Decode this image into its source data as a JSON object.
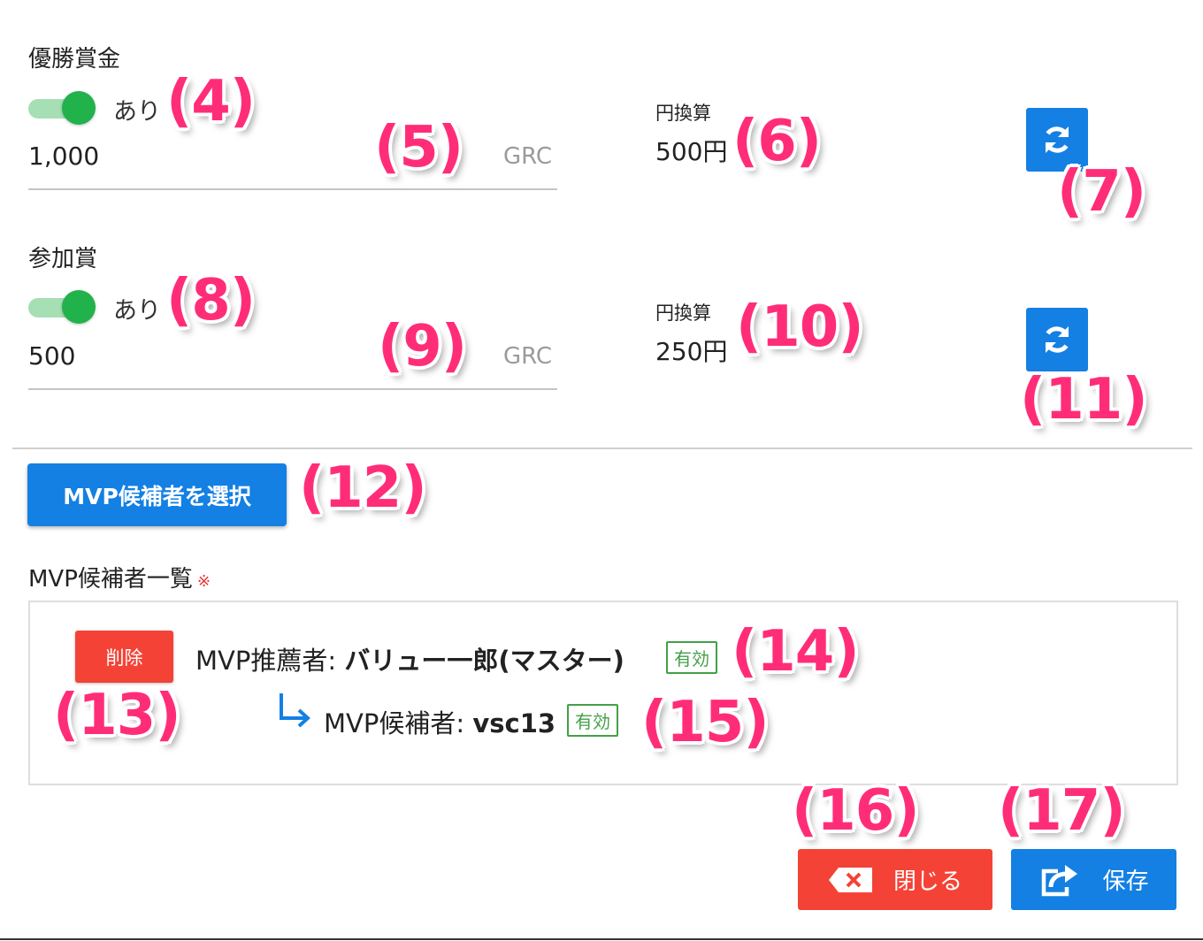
{
  "grand_prize": {
    "label": "優勝賞金",
    "toggle_label": "あり",
    "amount": "1,000",
    "unit": "GRC",
    "yen_label": "円換算",
    "yen_value": "500円"
  },
  "participation_prize": {
    "label": "参加賞",
    "toggle_label": "あり",
    "amount": "500",
    "unit": "GRC",
    "yen_label": "円換算",
    "yen_value": "250円"
  },
  "select_mvp_button": "MVP候補者を選択",
  "mvp_list": {
    "label": "MVP候補者一覧",
    "required_mark": "※",
    "delete_button": "削除",
    "recommender_prefix": "MVP推薦者: ",
    "recommender_name": "バリュー一郎(マスター)",
    "recommender_status": "有効",
    "candidate_prefix": "MVP候補者: ",
    "candidate_name": "vsc13",
    "candidate_status": "有効"
  },
  "actions": {
    "close_label": "閉じる",
    "save_label": "保存"
  },
  "annotations": [
    "(4)",
    "(5)",
    "(6)",
    "(7)",
    "(8)",
    "(9)",
    "(10)",
    "(11)",
    "(12)",
    "(13)",
    "(14)",
    "(15)",
    "(16)",
    "(17)"
  ],
  "colors": {
    "primary": "#1480e3",
    "danger": "#f44336",
    "toggle_on": "#22b24c",
    "valid_badge": "#43a047",
    "callout": "#ff2d78"
  },
  "icons": [
    "refresh-icon",
    "return-arrow-icon",
    "backspace-x-icon",
    "share-export-icon"
  ]
}
